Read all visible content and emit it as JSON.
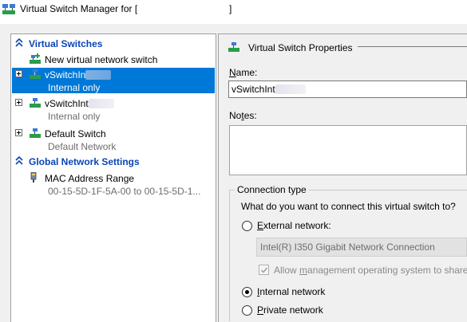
{
  "window": {
    "title": "Virtual Switch Manager for [",
    "title_tail": "]"
  },
  "left": {
    "virtual_switches_header": "Virtual Switches",
    "new_switch_label": "New virtual network switch",
    "switches": [
      {
        "name": "vSwitchIn",
        "type": "Internal only",
        "selected": true
      },
      {
        "name": "vSwitchInt",
        "type": "Internal only",
        "selected": false
      },
      {
        "name": "Default Switch",
        "type": "Default Network",
        "selected": false
      }
    ],
    "global_header": "Global Network Settings",
    "mac_label": "MAC Address Range",
    "mac_value": "00-15-5D-1F-5A-00 to 00-15-5D-1..."
  },
  "right": {
    "section_title": "Virtual Switch Properties",
    "name_label": "Name:",
    "name_value": "vSwitchInt",
    "notes_label": "Notes:",
    "notes_value": "",
    "connection_type_label": "Connection type",
    "question": "What do you want to connect this virtual switch to?",
    "options": [
      {
        "label": "External network:",
        "checked": false
      },
      {
        "label": "Internal network",
        "checked": true
      },
      {
        "label": "Private network",
        "checked": false
      }
    ],
    "external_adapter": "Intel(R) I350 Gigabit Network Connection",
    "allow_mgmt_label": "Allow management operating system to share",
    "allow_mgmt_checked": true
  },
  "colors": {
    "selection": "#0078d7",
    "section_header": "#0b45b6",
    "secondary_text": "#6d6d6d"
  },
  "icons": [
    "virtual-switch-icon",
    "new-switch-icon",
    "mac-range-icon",
    "expand-icon",
    "collapse-chevron-icon"
  ]
}
